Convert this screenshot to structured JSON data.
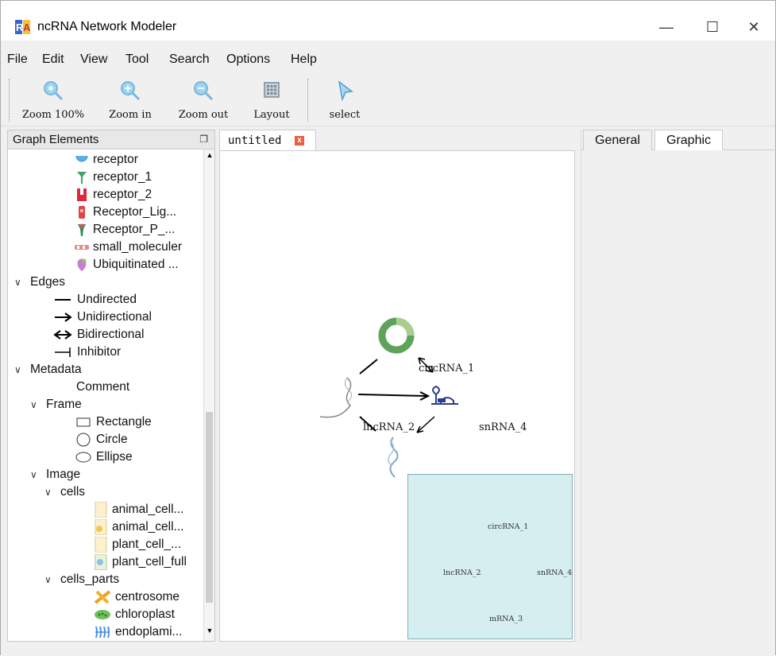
{
  "window": {
    "title": "ncRNA Network Modeler",
    "minimize": "—",
    "maximize": "☐",
    "close": "✕"
  },
  "menu": [
    "File",
    "Edit",
    "View",
    "Tool",
    "Search",
    "Options",
    "Help"
  ],
  "toolbar": {
    "zoom100": "Zoom 100%",
    "zoomin": "Zoom in",
    "zoomout": "Zoom out",
    "layout": "Layout",
    "select": "select"
  },
  "graph_elements": {
    "title": "Graph Elements",
    "float_icon": "restore-icon",
    "nodes": [
      "receptor",
      "receptor_1",
      "receptor_2",
      "Receptor_Lig...",
      "Receptor_P_...",
      "small_moleculer",
      "Ubiquitinated ..."
    ],
    "edges_label": "Edges",
    "edges": [
      "Undirected",
      "Unidirectional",
      "Bidirectional",
      "Inhibitor"
    ],
    "metadata_label": "Metadata",
    "comment": "Comment",
    "frame_label": "Frame",
    "frames": [
      "Rectangle",
      "Circle",
      "Ellipse"
    ],
    "image_label": "Image",
    "cells_label": "cells",
    "cells": [
      "animal_cell...",
      "animal_cell...",
      "plant_cell_...",
      "plant_cell_full"
    ],
    "cells_parts_label": "cells_parts",
    "cells_parts": [
      "centrosome",
      "chloroplast",
      "endoplami..."
    ]
  },
  "document": {
    "tab": "untitled",
    "tab_close": "x"
  },
  "graph": {
    "circ": "circRNA_1",
    "lnc": "lncRNA_2",
    "sn": "snRNA_4",
    "m": "mRNA_3"
  },
  "properties": {
    "tabs": [
      "General",
      "Graphic"
    ],
    "active": "Graphic"
  },
  "colors": {
    "accent": "#3b7fc4",
    "circ_green": "#6fae6a",
    "minimap_bg": "#d6eef0",
    "close_red": "#e8603c"
  }
}
